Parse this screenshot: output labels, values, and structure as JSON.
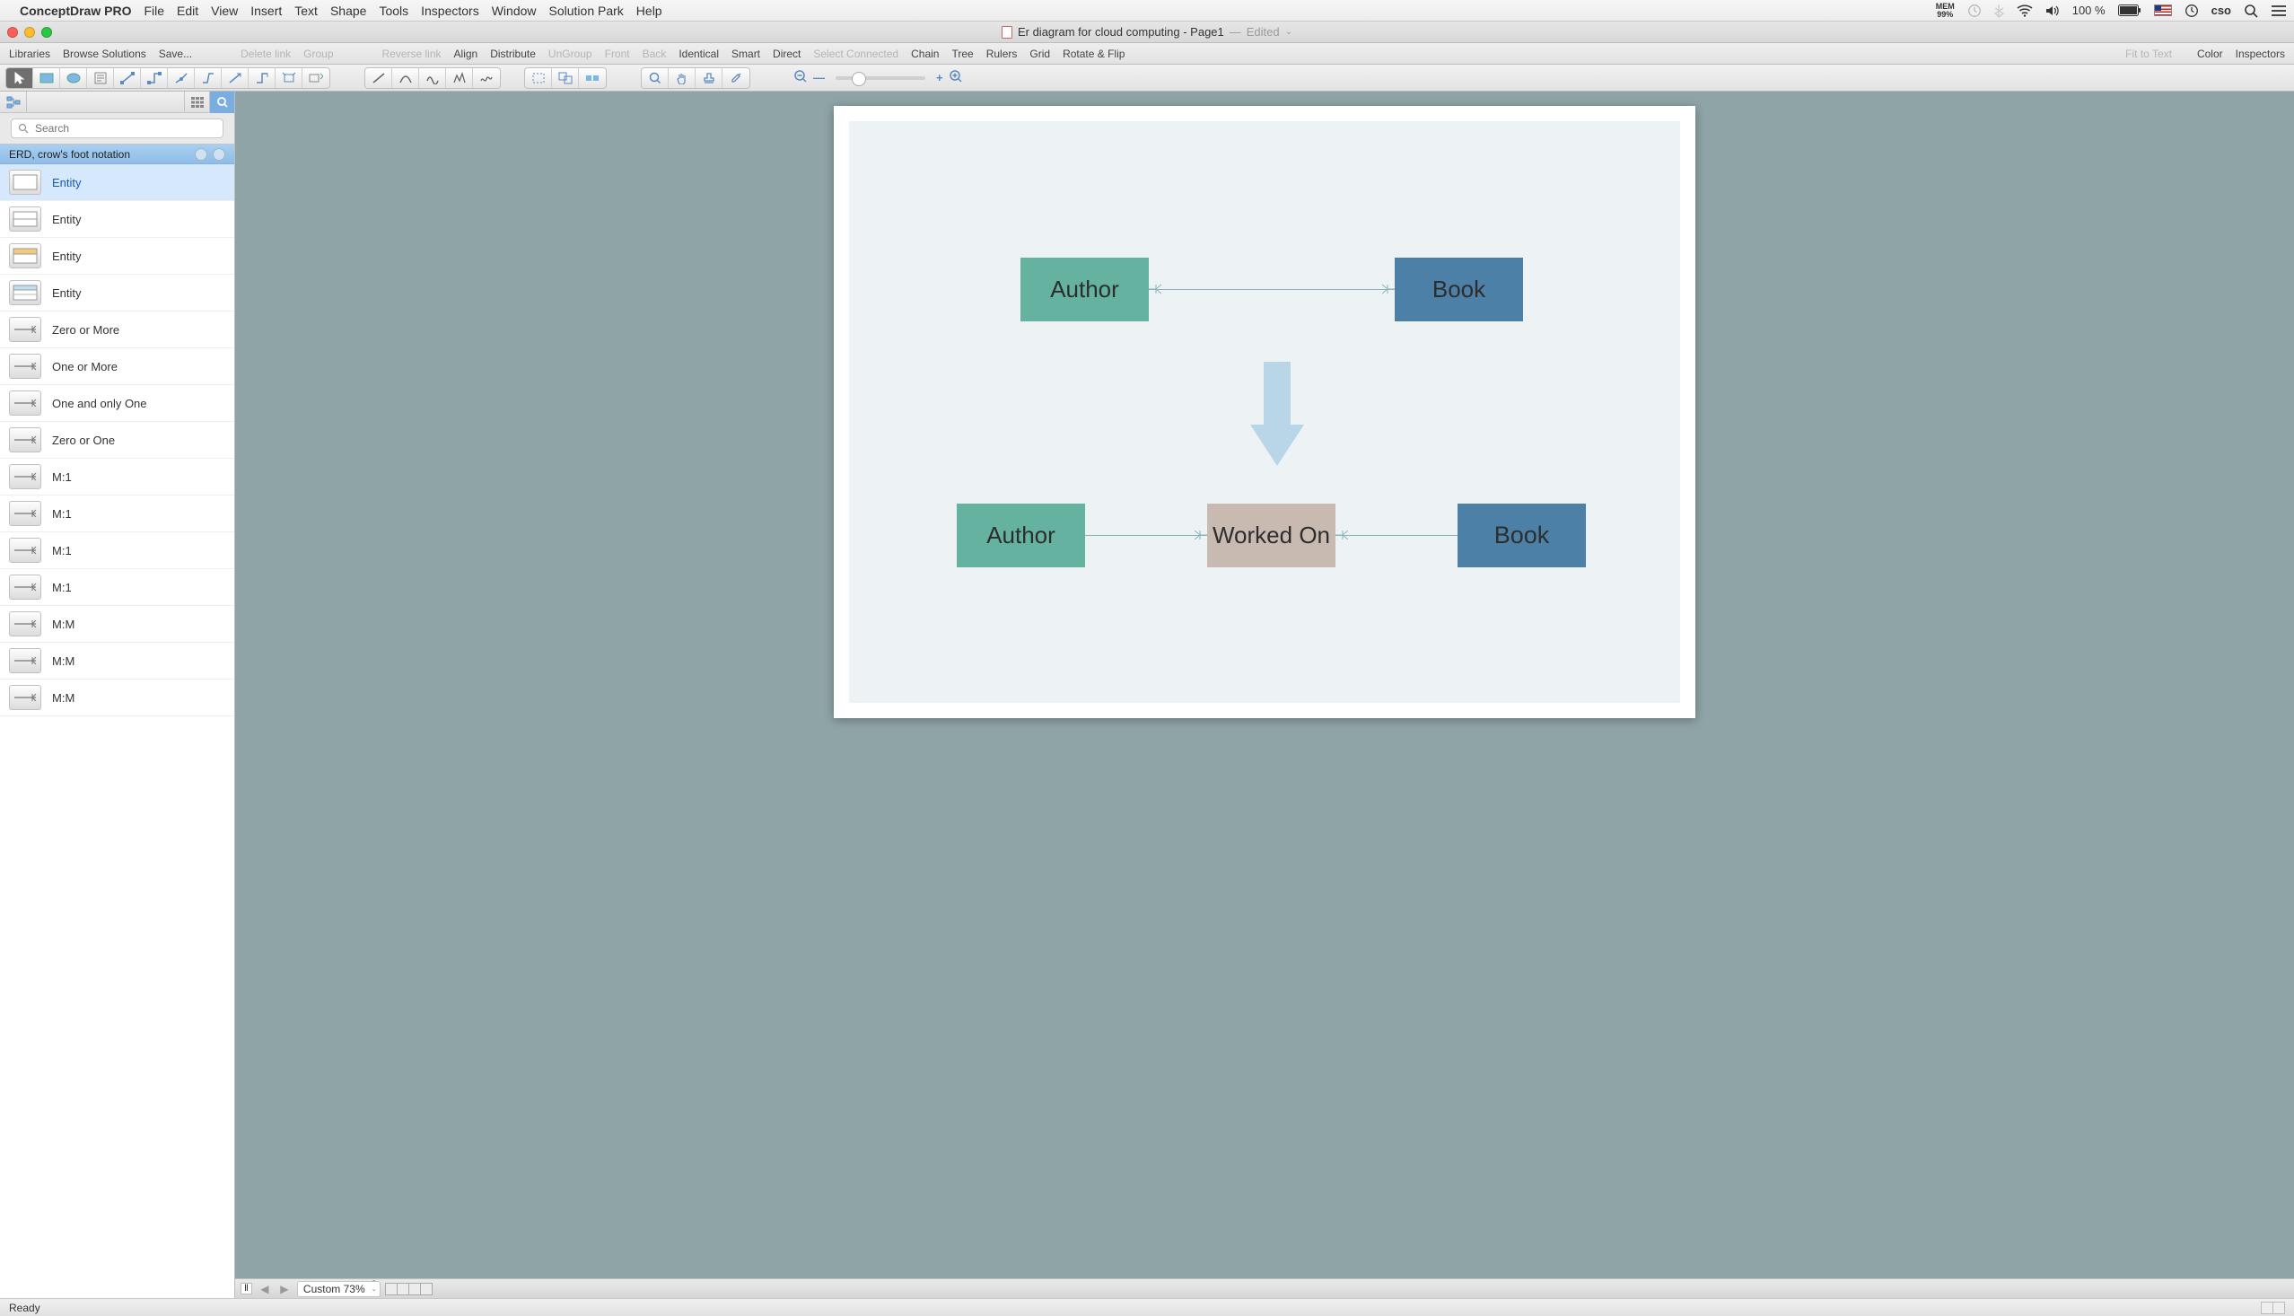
{
  "menubar": {
    "app_name": "ConceptDraw PRO",
    "items": [
      "File",
      "Edit",
      "View",
      "Insert",
      "Text",
      "Shape",
      "Tools",
      "Inspectors",
      "Window",
      "Solution Park",
      "Help"
    ],
    "right": {
      "mem_label": "MEM",
      "mem_pct": "99%",
      "battery_pct": "100 %",
      "user": "cso"
    }
  },
  "window": {
    "title": "Er diagram for cloud computing - Page1",
    "edited_label": "Edited",
    "separator": "—"
  },
  "secbar": {
    "left": [
      "Libraries",
      "Browse Solutions",
      "Save..."
    ],
    "dim1": [
      "Delete link",
      "Group"
    ],
    "dim2": [
      "Reverse link"
    ],
    "mid_active": [
      "Align",
      "Distribute"
    ],
    "dim3": [
      "UnGroup",
      "Front",
      "Back"
    ],
    "mid_active2": [
      "Identical",
      "Smart",
      "Direct"
    ],
    "dim4": [
      "Select Connected"
    ],
    "active2": [
      "Chain",
      "Tree",
      "Rulers",
      "Grid",
      "Rotate & Flip"
    ],
    "dim_right": "Fit to Text",
    "right": [
      "Color",
      "Inspectors"
    ]
  },
  "sidebar": {
    "search_placeholder": "Search",
    "library_title": "ERD, crow's foot notation",
    "items": [
      {
        "label": "Entity",
        "kind": "entity-blank",
        "selected": true
      },
      {
        "label": "Entity",
        "kind": "entity-2row"
      },
      {
        "label": "Entity",
        "kind": "entity-hdr"
      },
      {
        "label": "Entity",
        "kind": "entity-hdr2"
      },
      {
        "label": "Zero or More",
        "kind": "rel"
      },
      {
        "label": "One or More",
        "kind": "rel"
      },
      {
        "label": "One and only One",
        "kind": "rel"
      },
      {
        "label": "Zero or One",
        "kind": "rel"
      },
      {
        "label": "M:1",
        "kind": "rel"
      },
      {
        "label": "M:1",
        "kind": "rel"
      },
      {
        "label": "M:1",
        "kind": "rel"
      },
      {
        "label": "M:1",
        "kind": "rel"
      },
      {
        "label": "M:M",
        "kind": "rel"
      },
      {
        "label": "M:M",
        "kind": "rel"
      },
      {
        "label": "M:M",
        "kind": "rel"
      }
    ]
  },
  "canvas": {
    "zoom_label": "Custom 73%",
    "entities": {
      "author1": "Author",
      "book1": "Book",
      "author2": "Author",
      "worked": "Worked On",
      "book2": "Book"
    }
  },
  "status": {
    "ready": "Ready"
  }
}
